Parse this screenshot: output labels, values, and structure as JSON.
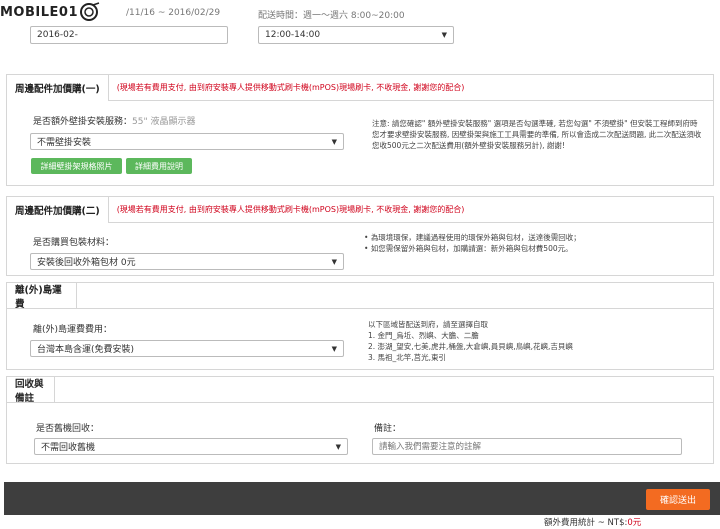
{
  "logo": {
    "text": "MOBILE01"
  },
  "top": {
    "date_range": "/11/16 ~ 2016/02/29",
    "delivery_time_label": "配送時間：週一～週六 8:00~20:00",
    "date_value": "2016-02-",
    "time_value": "12:00-14:00"
  },
  "section1": {
    "title": "周邊配件加價購(一)",
    "notice": "(現場若有費用支付, 由到府安裝專人提供移動式刷卡機(mPOS)現場刷卡, 不收現金, 謝謝您的配合)",
    "question": "是否額外壁掛安裝服務：",
    "hint": "55\" 液晶顯示器",
    "select_value": "不需壁掛安裝",
    "btn_photos": "詳細壁掛架規格照片",
    "btn_fees": "詳細費用說明",
    "note": "注意: 請您確認\" 額外壁掛安裝服務\" 選項是否勾選準確, 若您勾選\" 不須壁掛\" 但安裝工程師到府時您才要求壁掛安裝服務, 因壁掛架與施工工具需要的準備, 所以會造成二次配送問題, 此二次配送須收您收500元之二次配送費用(額外壁掛安裝服務另計), 謝謝!"
  },
  "section2": {
    "title": "周邊配件加價購(二)",
    "notice": "(現場若有費用支付, 由到府安裝專人提供移動式刷卡機(mPOS)現場刷卡, 不收現金, 謝謝您的配合)",
    "question": "是否購買包裝材料：",
    "select_value": "安裝後回收外箱包材 0元",
    "notes": [
      "為環境環保，建議過程使用的環保外箱與包材，送達後需回收；",
      "如您需保留外箱與包材，加購請選：新外箱與包材費500元。"
    ]
  },
  "section3": {
    "title": "離(外)島運費",
    "question": "離(外)島運費費用：",
    "select_value": "台灣本島含運(免費安裝)",
    "note_title": "以下區域皆配送到府，請至選擇自取",
    "notes": [
      "1. 金門_烏坵、烈嶼、大膽、二膽",
      "2. 澎湖_望安,七美,虎井,桶盤,大倉嶼,員貝嶼,鳥嶼,花嶼,吉貝嶼",
      "3. 馬祖_北竿,莒光,東引"
    ]
  },
  "section4": {
    "title": "回收與備註",
    "recycle_question": "是否舊機回收：",
    "recycle_value": "不需回收舊機",
    "remark_label": "備註：",
    "remark_placeholder": "請輸入我們需要注意的註解"
  },
  "footer": {
    "confirm_label": "確認送出",
    "total_label": "額外費用統計 ~ NT$:",
    "total_value": "0元"
  },
  "colors": {
    "notice_red": "#d0021b",
    "green": "#5cb85c",
    "orange": "#f36b21",
    "footer_dark": "#3e3e3e"
  }
}
